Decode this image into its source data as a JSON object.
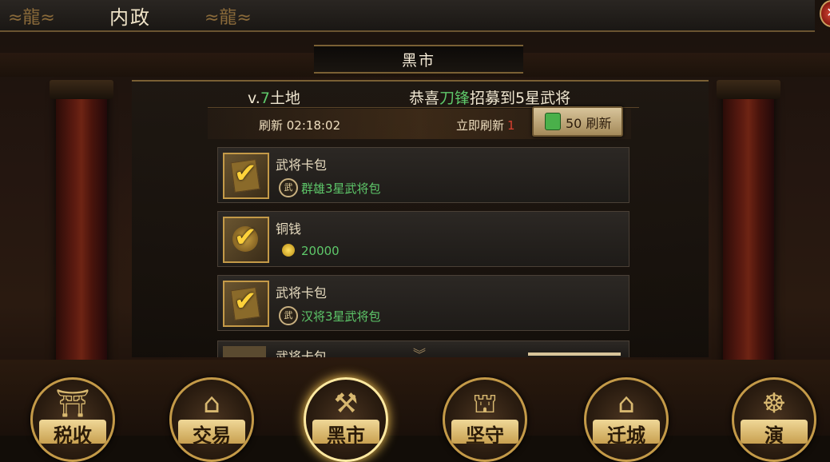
{
  "header": {
    "title": "内政",
    "close_symbol": "✕"
  },
  "market": {
    "title": "黑市"
  },
  "info": {
    "level_prefix": "v.",
    "level_num": "7",
    "level_suffix": "土地",
    "news_prefix": "恭喜",
    "news_name": "刀锋",
    "news_suffix": "招募到5星武将"
  },
  "refresh": {
    "timer_label": "刷新 02:18:02",
    "instant_label": "立即刷新",
    "instant_count": "1",
    "button_label": "50 刷新"
  },
  "items": [
    {
      "name": "武将卡包",
      "badge": "武",
      "desc": "群雄3星武将包",
      "icon": "card-icon"
    },
    {
      "name": "铜钱",
      "desc": "20000",
      "icon": "coin-icon"
    },
    {
      "name": "武将卡包",
      "badge": "武",
      "desc": "汉将3星武将包",
      "icon": "card-icon"
    },
    {
      "name": "武将卡包",
      "icon": "card-icon"
    }
  ],
  "nav": [
    {
      "label": "税收",
      "icon": "tax-icon"
    },
    {
      "label": "交易",
      "icon": "trade-icon"
    },
    {
      "label": "黑市",
      "icon": "black-market-icon"
    },
    {
      "label": "坚守",
      "icon": "defend-icon"
    },
    {
      "label": "迁城",
      "icon": "relocate-icon"
    },
    {
      "label": "演",
      "icon": "chariot-icon"
    }
  ],
  "colors": {
    "accent_green": "#5ec86a",
    "accent_gold": "#c49a48",
    "alert_red": "#d84030"
  }
}
